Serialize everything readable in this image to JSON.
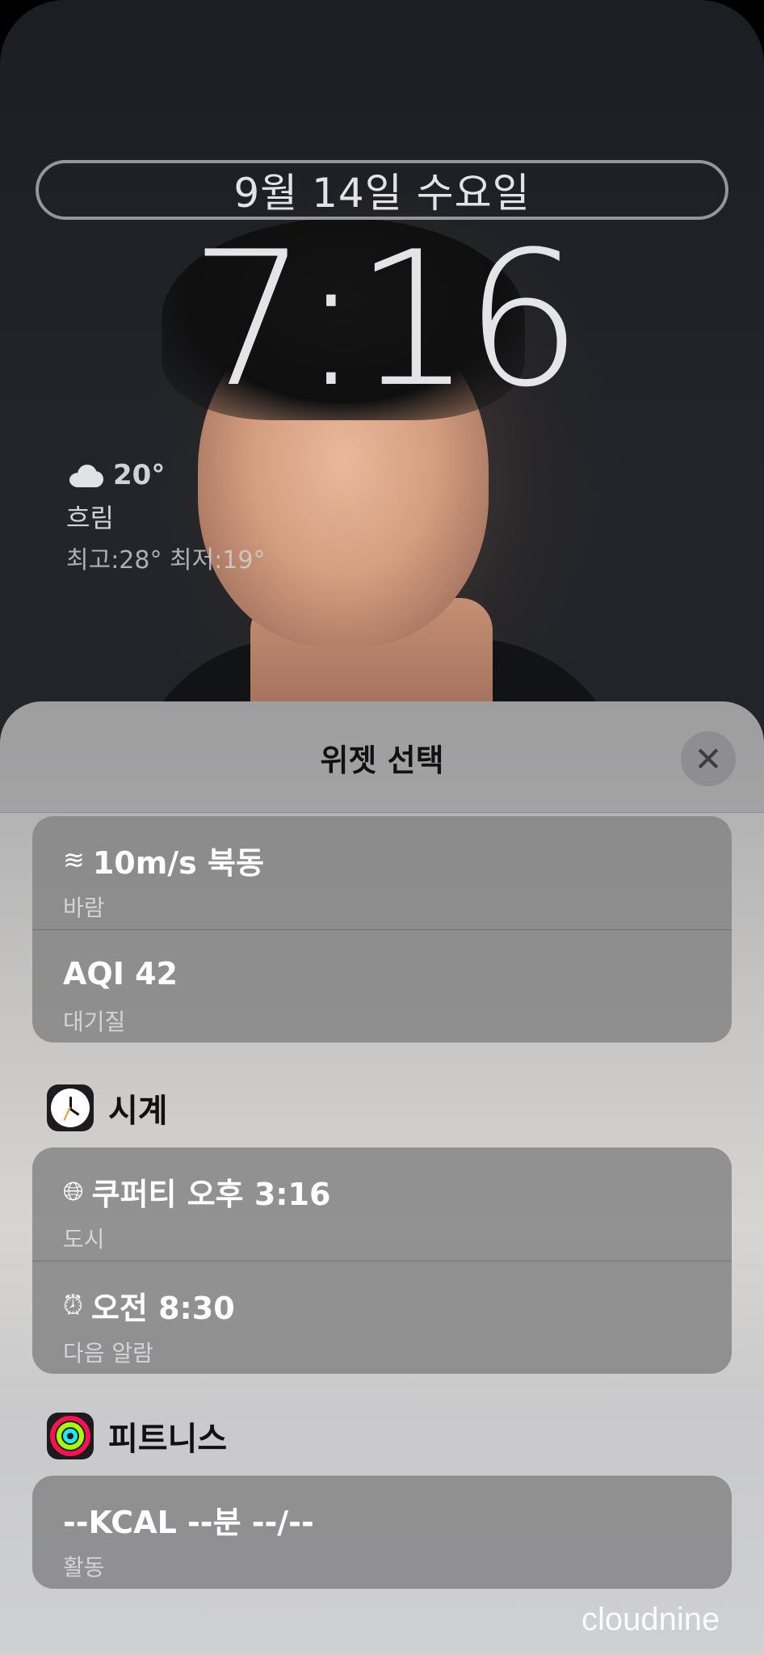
{
  "lockscreen": {
    "date": "9월 14일 수요일",
    "time": "7:16",
    "weather": {
      "icon": "cloud-icon",
      "temperature": "20°",
      "condition": "흐림",
      "high_low": "최고:28° 최저:19°"
    }
  },
  "sheet": {
    "title": "위젯 선택",
    "close_icon": "close-icon",
    "weather_card": [
      {
        "icon": "wind-icon",
        "value": "10m/s 북동",
        "label": "바람"
      },
      {
        "value": "AQI 42",
        "label": "대기질"
      }
    ],
    "clock_section": {
      "app_name": "시계",
      "icon": "clock-app-icon",
      "rows": [
        {
          "icon": "globe-icon",
          "value": "쿠퍼티 오후 3:16",
          "label": "도시"
        },
        {
          "icon": "alarm-clock-icon",
          "value": "오전 8:30",
          "label": "다음 알람"
        }
      ]
    },
    "fitness_section": {
      "app_name": "피트니스",
      "icon": "activity-rings-icon",
      "rows": [
        {
          "value": "--KCAL --분 --/--",
          "label": "활동"
        }
      ]
    }
  },
  "watermark": "cloudnine",
  "colors": {
    "sheet_bg": "#c9c8c6",
    "card_bg": "#828284",
    "ring_red": "#fa114f",
    "ring_green": "#a6ff00",
    "ring_blue": "#1eeaef",
    "clock_second_hand": "#f29a1e"
  }
}
